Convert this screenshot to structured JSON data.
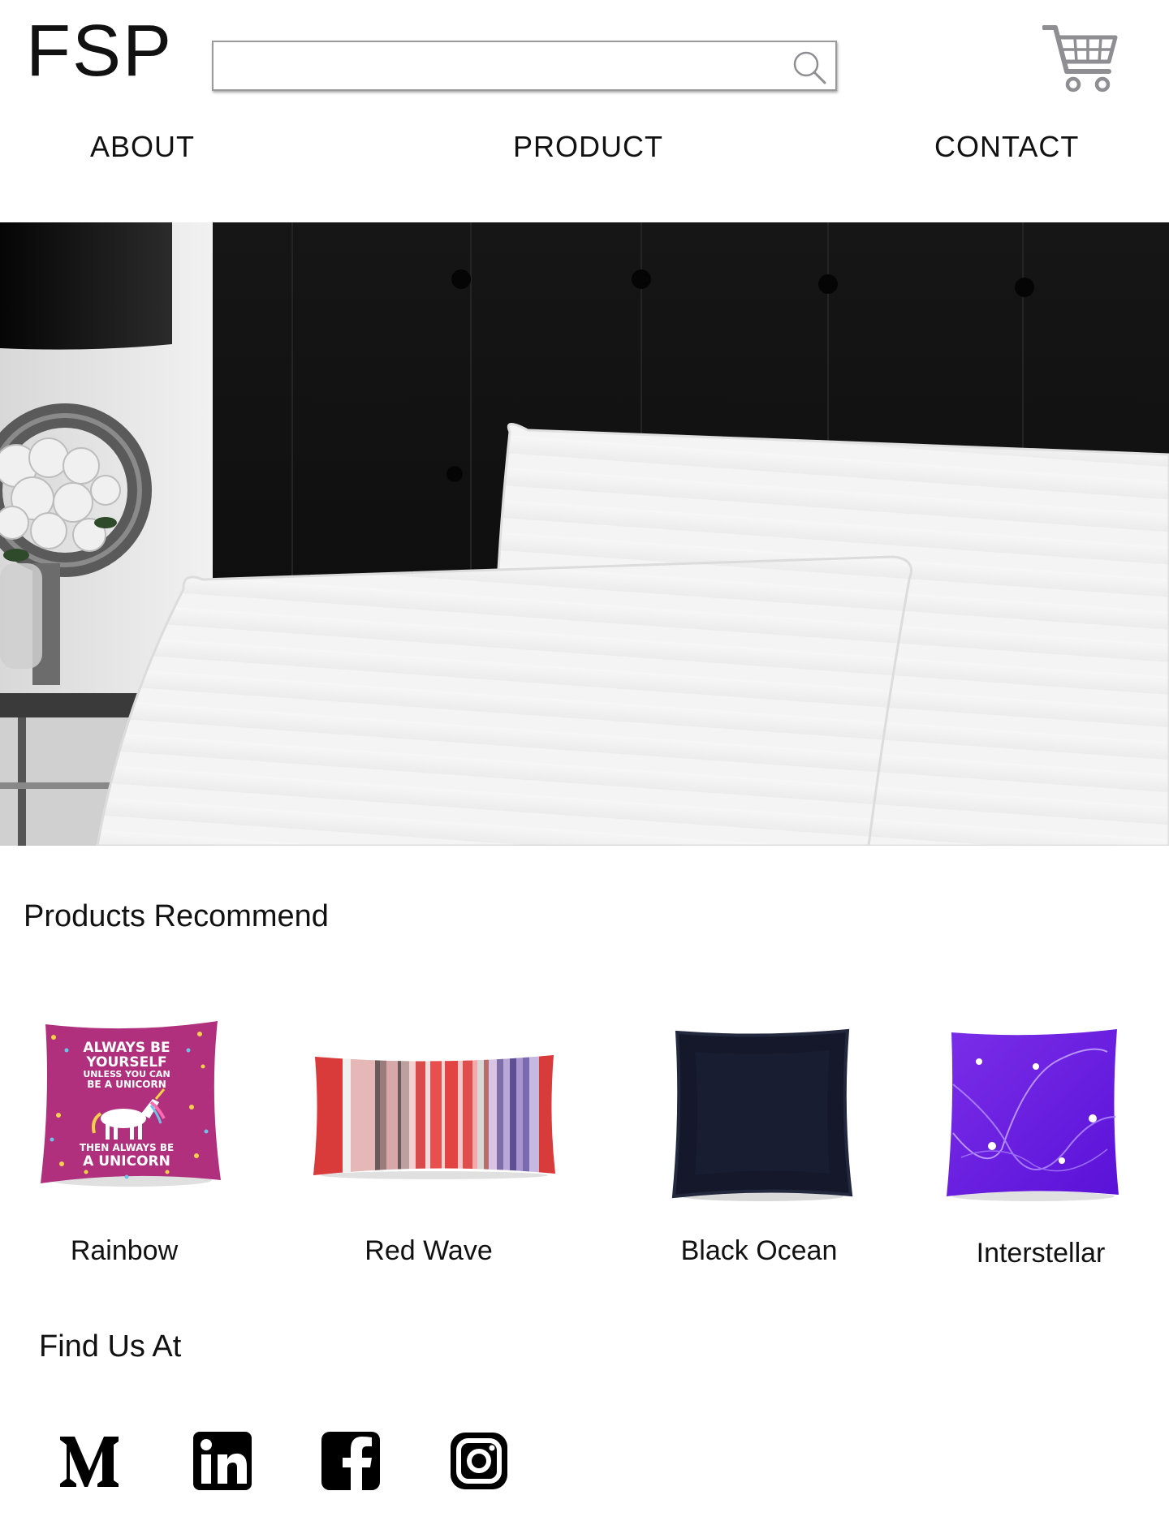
{
  "header": {
    "logo": "FSP",
    "search": {
      "value": "",
      "placeholder": ""
    },
    "icons": {
      "search": "search-icon",
      "cart": "shopping-cart-icon"
    }
  },
  "nav": {
    "items": [
      {
        "label": "ABOUT"
      },
      {
        "label": "PRODUCT"
      },
      {
        "label": "CONTACT"
      }
    ]
  },
  "hero": {
    "icon": "hero-banner-pillows-image"
  },
  "products": {
    "title": "Products Recommend",
    "items": [
      {
        "name": "Rainbow",
        "color": "#b0307e",
        "print": [
          "ALWAYS BE",
          "YOURSELF",
          "UNLESS YOU CAN",
          "BE A UNICORN",
          "THEN ALWAYS BE",
          "A UNICORN"
        ]
      },
      {
        "name": "Red Wave",
        "color": "#d93a3a"
      },
      {
        "name": "Black Ocean",
        "color": "#14182a"
      },
      {
        "name": "Interstellar",
        "color": "#6a1fe0"
      }
    ]
  },
  "social": {
    "title": "Find Us At",
    "items": [
      {
        "name": "medium-icon"
      },
      {
        "name": "linkedin-icon"
      },
      {
        "name": "facebook-icon"
      },
      {
        "name": "instagram-icon"
      }
    ]
  },
  "colors": {
    "text": "#111111",
    "search_border": "#9a9a9a",
    "cart": "#8e8e93"
  }
}
